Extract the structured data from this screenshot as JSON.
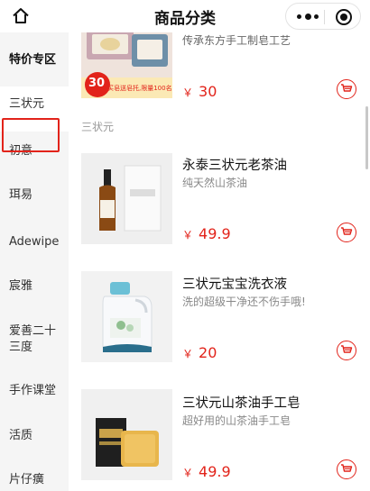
{
  "header": {
    "title": "商品分类",
    "home_icon": "home-icon",
    "more_icon": "more-dots-icon",
    "close_icon": "target-close-icon"
  },
  "sidebar": {
    "items": [
      {
        "label": "特价专区"
      },
      {
        "label": "三状元"
      },
      {
        "label": "初意"
      },
      {
        "label": "珥易"
      },
      {
        "label": "Adewipe"
      },
      {
        "label": "宸雅"
      },
      {
        "label": "爱善二十三度"
      },
      {
        "label": "手作课堂"
      },
      {
        "label": "活质"
      },
      {
        "label": "片仔癀"
      }
    ],
    "active_index": 1
  },
  "content": {
    "top_product": {
      "name_partial": "传承东方手工制皂工艺",
      "price_symbol": "￥",
      "price": "30",
      "badge_number": "30",
      "badge_text": "买皂送皂托,限量100名"
    },
    "section_title": "三状元",
    "products": [
      {
        "name": "永泰三状元老茶油",
        "desc": "纯天然山茶油",
        "price_symbol": "￥",
        "price": "49.9",
        "image": "tea-oil-bottle"
      },
      {
        "name": "三状元宝宝洗衣液",
        "desc": "洗的超级干净还不伤手哦!",
        "price_symbol": "￥",
        "price": "20",
        "image": "laundry-detergent-bottle"
      },
      {
        "name": "三状元山茶油手工皂",
        "desc": "超好用的山茶油手工皂",
        "price_symbol": "￥",
        "price": "49.9",
        "image": "handmade-soap"
      }
    ]
  },
  "colors": {
    "accent": "#e2231a",
    "sidebar_bg": "#f5f5f5",
    "muted_text": "#888888"
  }
}
